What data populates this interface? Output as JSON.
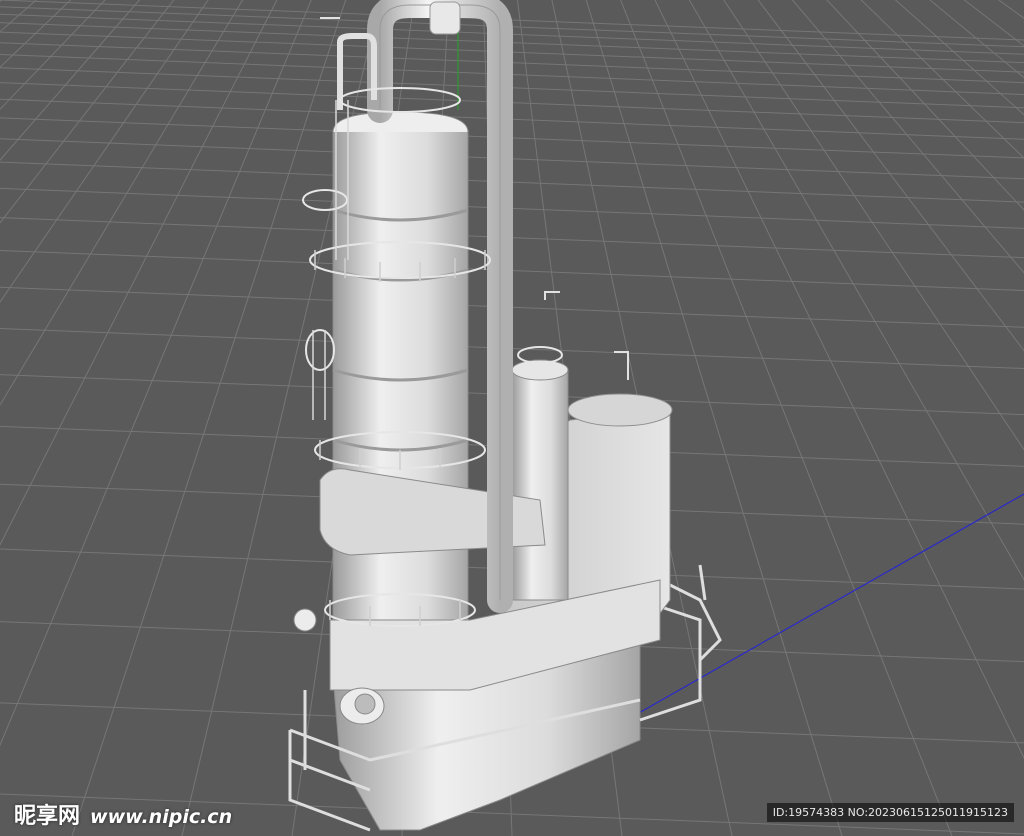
{
  "viewport": {
    "background": "#5a5a5a",
    "grid_color": "#7a7a7a",
    "x_axis_color": "#2a2ac8",
    "y_axis_color": "#2e9a2e",
    "model": "industrial process tower with platforms, ladders and pipes"
  },
  "watermark": {
    "site_name": "昵享网",
    "site_url": "www.nipic.cn",
    "image_info": "ID:19574383 NO:20230615125011915123"
  }
}
